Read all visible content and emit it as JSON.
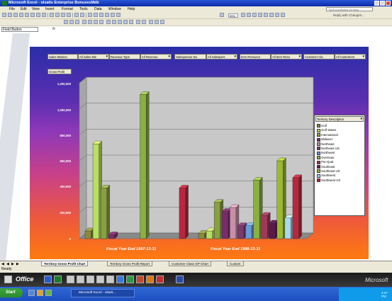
{
  "window": {
    "title": "Microsoft Excel - olsalts Enterprise BonusesMdb",
    "help_placeholder": "Type a question for help"
  },
  "menu": [
    "File",
    "Edit",
    "View",
    "Insert",
    "Format",
    "Tools",
    "Data",
    "Window",
    "Help"
  ],
  "toolbar": {
    "zoom": "95%",
    "reply_text": "Reply with Changes..."
  },
  "formula_bar": {
    "name_box": "Field Button",
    "fx": "fx"
  },
  "pivot": {
    "page_fields": [
      {
        "label": "Sales Mission"
      },
      {
        "label": "All Sales Mis"
      },
      {
        "label": "Revenue Type"
      },
      {
        "label": "All Revenue"
      },
      {
        "label": "Salesperson Na"
      },
      {
        "label": "All Salespers"
      },
      {
        "label": "Item Resource"
      },
      {
        "label": "All Item Reso"
      },
      {
        "label": "Customer Cla"
      },
      {
        "label": "All Customers"
      }
    ],
    "data_field": "Gross Profit",
    "legend_title": "Territory Description"
  },
  "chart_data": {
    "type": "bar",
    "ylabel": "",
    "ylim": [
      0,
      1200000
    ],
    "yticks": [
      "1,200,000",
      "1,000,000",
      "800,000",
      "600,000",
      "400,000",
      "200,000",
      "0"
    ],
    "categories": [
      "Fiscal Year End 1997-12-31",
      "Fiscal Year End 1998-12-31"
    ],
    "series": [
      {
        "name": "Golf",
        "color": "#8a8a3a",
        "values": [
          60000,
          40000
        ]
      },
      {
        "name": "Golf States",
        "color": "#b8e060",
        "values": [
          730000,
          60000
        ]
      },
      {
        "name": "International",
        "color": "#8aa040",
        "values": [
          390000,
          280000
        ]
      },
      {
        "name": "Midwest",
        "color": "#7a2a6a",
        "values": [
          30000,
          210000
        ]
      },
      {
        "name": "Northeast",
        "color": "#c890a8",
        "values": [
          0,
          240000
        ]
      },
      {
        "name": "Northeast US",
        "color": "#7a3a6a",
        "values": [
          0,
          100000
        ]
      },
      {
        "name": "Northwest",
        "color": "#6a9ad8",
        "values": [
          0,
          100000
        ]
      },
      {
        "name": "Overseas",
        "color": "#8ab040",
        "values": [
          1110000,
          450000
        ]
      },
      {
        "name": "Pre-Qual",
        "color": "#a03858",
        "values": [
          0,
          180000
        ]
      },
      {
        "name": "Southeast",
        "color": "#5a1a4a",
        "values": [
          0,
          120000
        ]
      },
      {
        "name": "Southeast US",
        "color": "#9aba30",
        "values": [
          0,
          600000
        ]
      },
      {
        "name": "Southwest",
        "color": "#a8d8f0",
        "values": [
          0,
          160000
        ]
      },
      {
        "name": "Southwest US",
        "color": "#b8283c",
        "values": [
          390000,
          470000
        ]
      }
    ],
    "grid": true,
    "legend_position": "right"
  },
  "sheet_tabs": {
    "tabs": [
      "Territory Gross Profit Chart",
      "Territory Gross Profit Report",
      "Customer Class GP Chart",
      "Custom"
    ],
    "active": 0
  },
  "status": {
    "text": "Ready"
  },
  "office_bar": {
    "label": "Office",
    "right_text": "Microsoft"
  },
  "taskbar": {
    "start": "Start",
    "item": "Microsoft Excel - olsalt...",
    "clock": "4:47 PM"
  }
}
